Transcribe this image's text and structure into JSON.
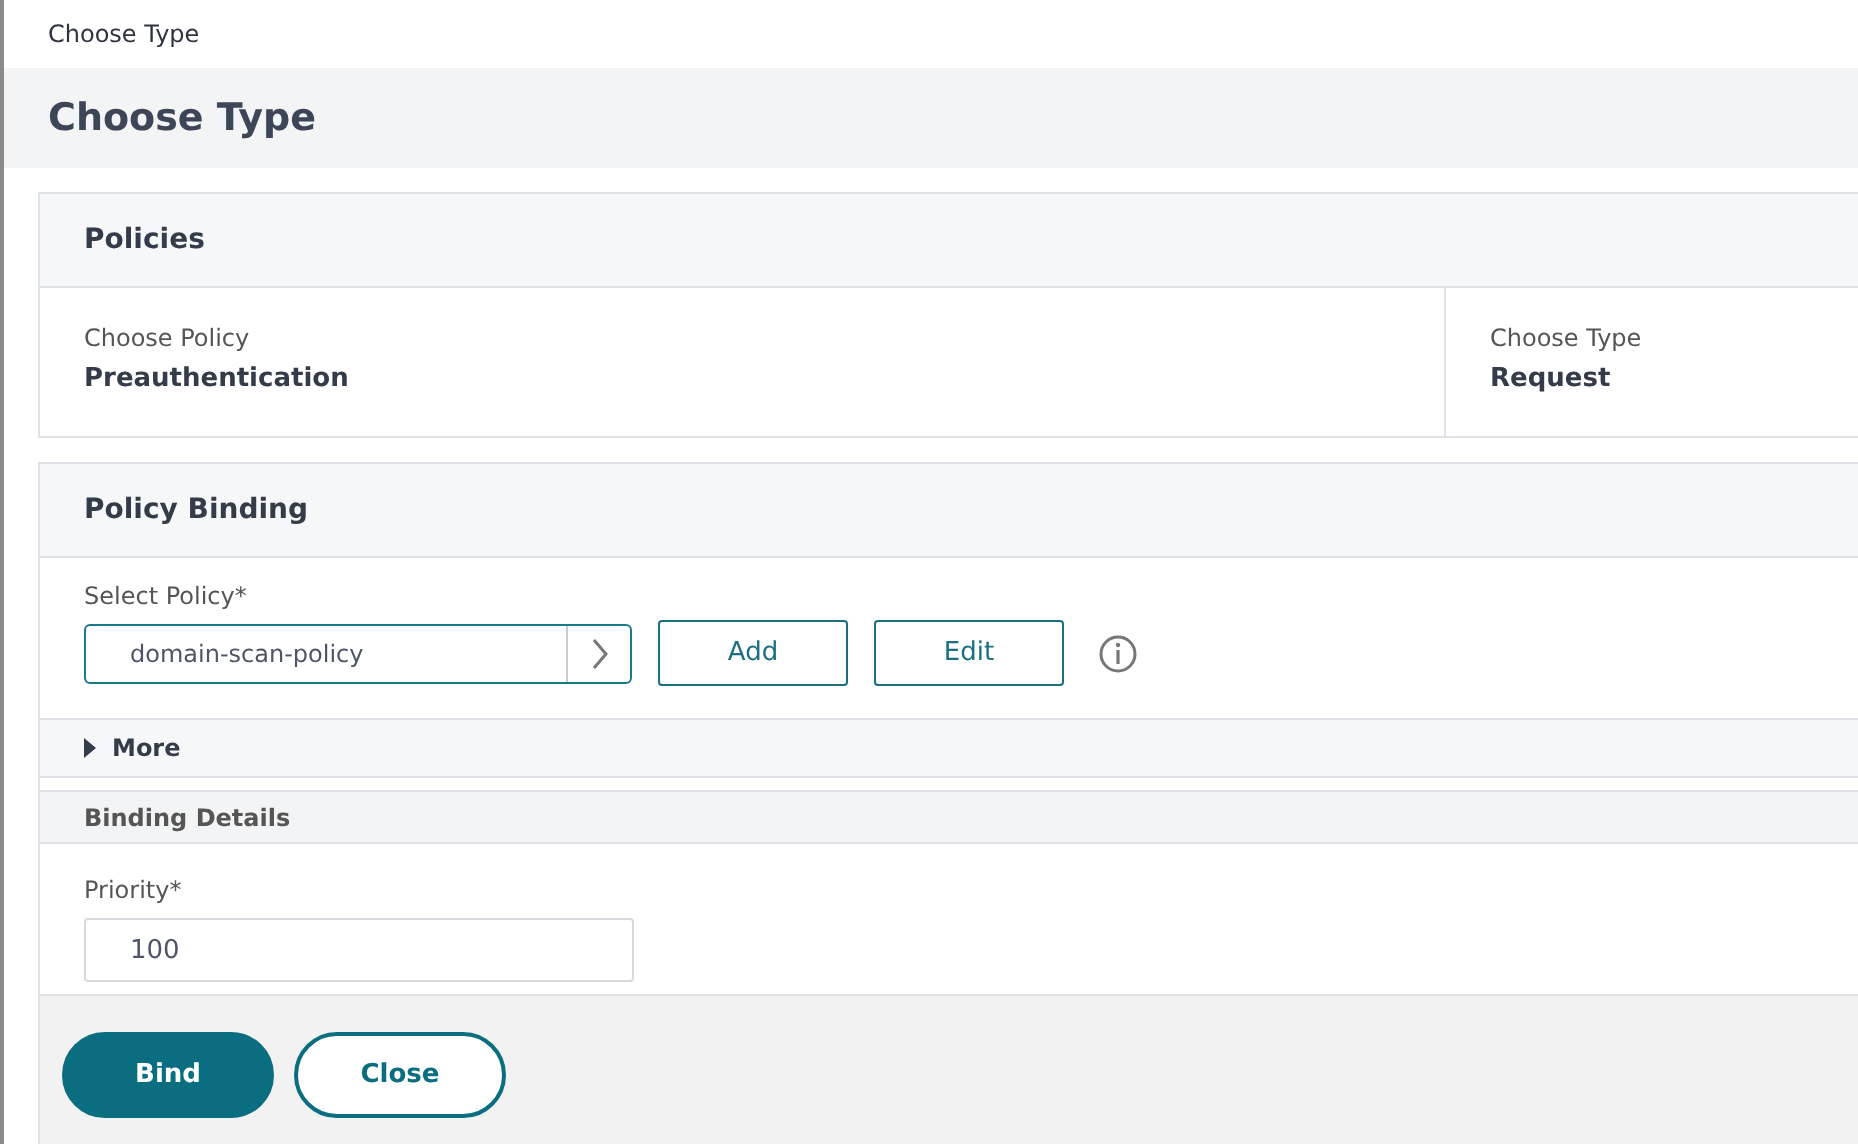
{
  "breadcrumb": "Choose Type",
  "title": "Choose Type",
  "policies": {
    "heading": "Policies",
    "columns": [
      {
        "label": "Choose Policy",
        "value": "Preauthentication"
      },
      {
        "label": "Choose Type",
        "value": "Request"
      }
    ]
  },
  "policy_binding": {
    "heading": "Policy Binding",
    "select_label": "Select Policy*",
    "select_value": "domain-scan-policy",
    "buttons": [
      "Add",
      "Edit"
    ],
    "more": {
      "label": "More",
      "expanded": false
    }
  },
  "binding_details": {
    "heading": "Binding Details",
    "priority_label": "Priority*",
    "priority_value": "100"
  },
  "footer_buttons": [
    {
      "label": "Bind",
      "kind": "primary"
    },
    {
      "label": "Close",
      "kind": "secondary"
    }
  ]
}
